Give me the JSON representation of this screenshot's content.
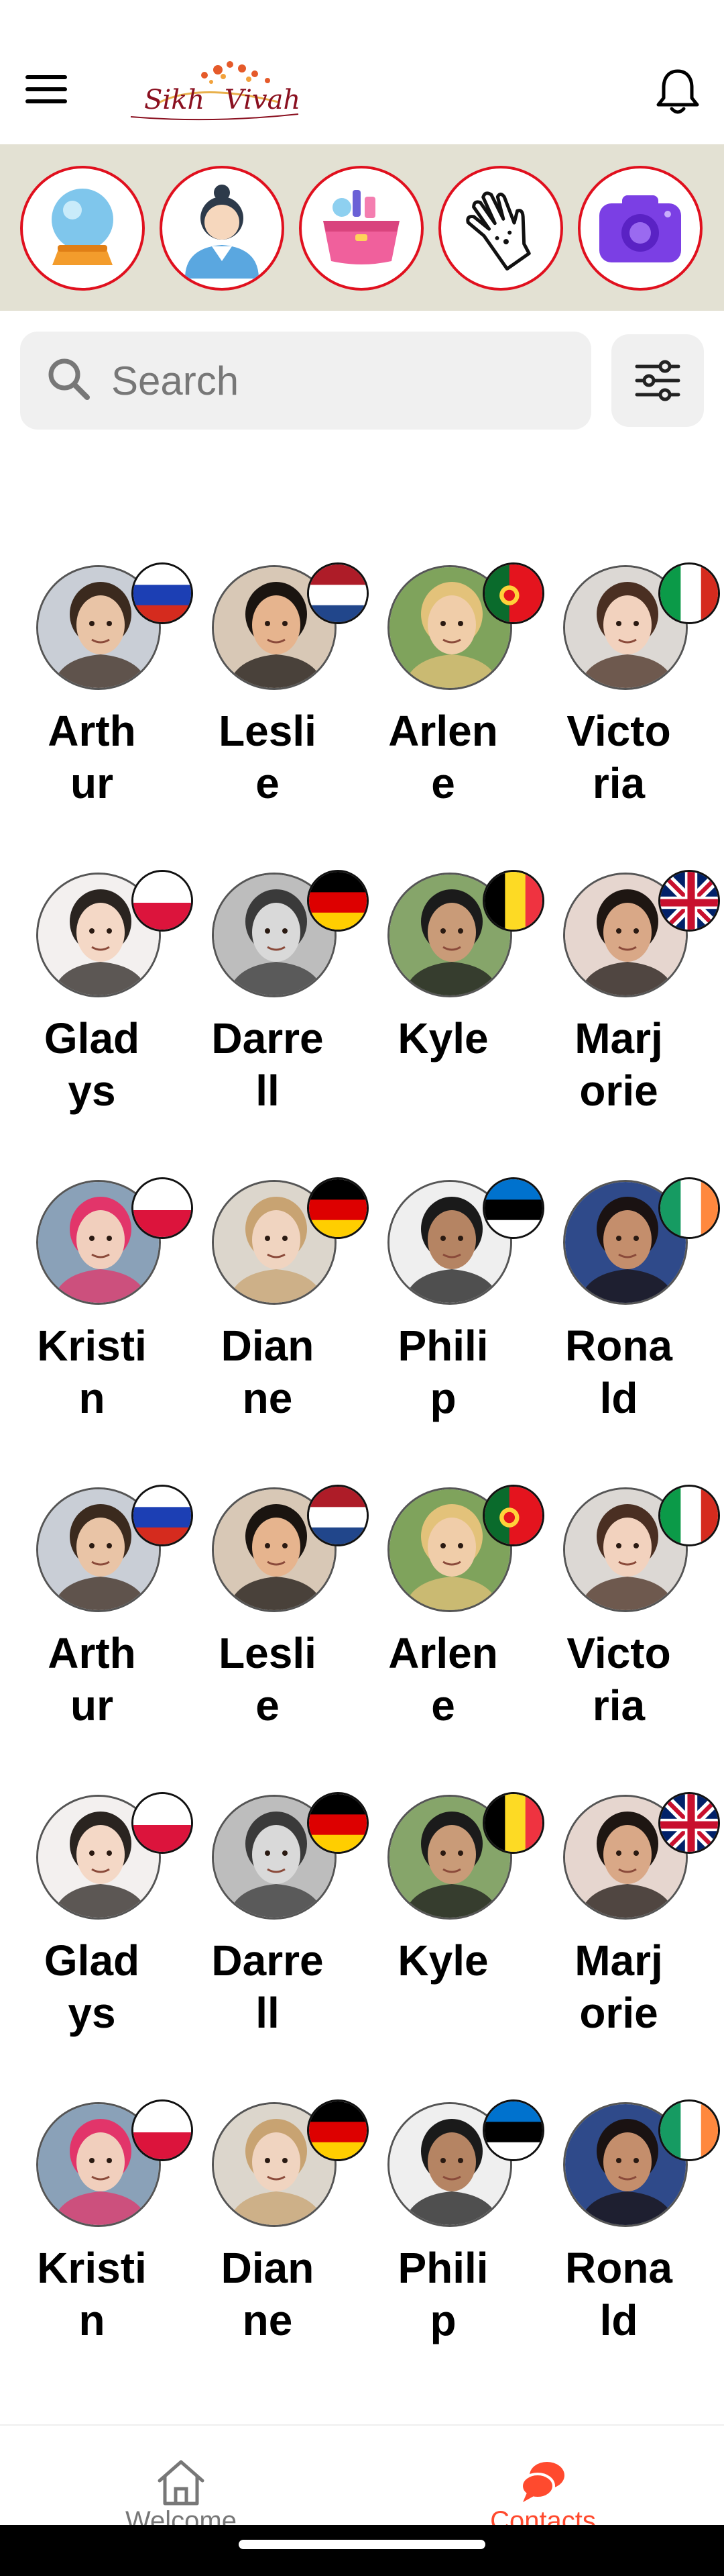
{
  "header": {
    "logo_text": "Sikh Vivah"
  },
  "categories": [
    {
      "name": "crystal-ball-icon"
    },
    {
      "name": "woman-assistant-icon"
    },
    {
      "name": "makeup-bag-icon"
    },
    {
      "name": "palm-hand-icon"
    },
    {
      "name": "camera-icon"
    }
  ],
  "search": {
    "placeholder": "Search"
  },
  "contacts": [
    {
      "name": "Arthur",
      "lines": [
        "Arth",
        "ur"
      ],
      "flag": "russia"
    },
    {
      "name": "Leslie",
      "lines": [
        "Lesli",
        "e"
      ],
      "flag": "netherlands"
    },
    {
      "name": "Arlene",
      "lines": [
        "Arlen",
        "e"
      ],
      "flag": "portugal"
    },
    {
      "name": "Victoria",
      "lines": [
        "Victo",
        "ria"
      ],
      "flag": "italy"
    },
    {
      "name": "Gladys",
      "lines": [
        "Glad",
        "ys"
      ],
      "flag": "poland"
    },
    {
      "name": "Darrell",
      "lines": [
        "Darre",
        "ll"
      ],
      "flag": "germany"
    },
    {
      "name": "Kyle",
      "lines": [
        "Kyle",
        ""
      ],
      "flag": "belgium"
    },
    {
      "name": "Marjorie",
      "lines": [
        "Marj",
        "orie"
      ],
      "flag": "uk"
    },
    {
      "name": "Kristin",
      "lines": [
        "Kristi",
        "n"
      ],
      "flag": "poland"
    },
    {
      "name": "Dianne",
      "lines": [
        "Dian",
        "ne"
      ],
      "flag": "germany"
    },
    {
      "name": "Philip",
      "lines": [
        "Phili",
        "p"
      ],
      "flag": "estonia"
    },
    {
      "name": "Ronald",
      "lines": [
        "Rona",
        "ld"
      ],
      "flag": "ireland"
    },
    {
      "name": "Arthur",
      "lines": [
        "Arth",
        "ur"
      ],
      "flag": "russia"
    },
    {
      "name": "Leslie",
      "lines": [
        "Lesli",
        "e"
      ],
      "flag": "netherlands"
    },
    {
      "name": "Arlene",
      "lines": [
        "Arlen",
        "e"
      ],
      "flag": "portugal"
    },
    {
      "name": "Victoria",
      "lines": [
        "Victo",
        "ria"
      ],
      "flag": "italy"
    },
    {
      "name": "Gladys",
      "lines": [
        "Glad",
        "ys"
      ],
      "flag": "poland"
    },
    {
      "name": "Darrell",
      "lines": [
        "Darre",
        "ll"
      ],
      "flag": "germany"
    },
    {
      "name": "Kyle",
      "lines": [
        "Kyle",
        ""
      ],
      "flag": "belgium"
    },
    {
      "name": "Marjorie",
      "lines": [
        "Marj",
        "orie"
      ],
      "flag": "uk"
    },
    {
      "name": "Kristin",
      "lines": [
        "Kristi",
        "n"
      ],
      "flag": "poland"
    },
    {
      "name": "Dianne",
      "lines": [
        "Dian",
        "ne"
      ],
      "flag": "germany"
    },
    {
      "name": "Philip",
      "lines": [
        "Phili",
        "p"
      ],
      "flag": "estonia"
    },
    {
      "name": "Ronald",
      "lines": [
        "Rona",
        "ld"
      ],
      "flag": "ireland"
    }
  ],
  "bottom_nav": {
    "welcome_label": "Welcome",
    "contacts_label": "Contacts",
    "active": "contacts",
    "active_color": "#ff4a2e",
    "inactive_color": "#777777"
  },
  "colors": {
    "category_bar_bg": "#e3e1d3",
    "category_border": "#e0101e",
    "search_bg": "#f0f0f0"
  }
}
